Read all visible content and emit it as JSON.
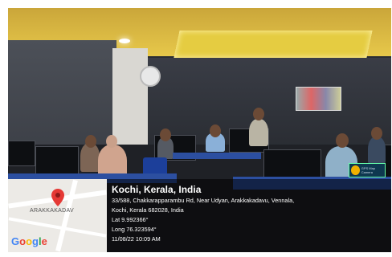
{
  "photo": {
    "description_colors": {
      "ceiling": "#e5cc41",
      "desk": "#2c4fa0",
      "overlay": "#000000"
    }
  },
  "map": {
    "label": "ARAKKAKADAV",
    "logo": "Google",
    "pin_icon": "map-pin-icon",
    "logo_colors": [
      "#4285F4",
      "#EA4335",
      "#FBBC05",
      "#4285F4",
      "#34A853",
      "#EA4335"
    ]
  },
  "location": {
    "title": "Kochi, Kerala, India",
    "address_line1": "33/588, Chakkarapparambu Rd, Near Udyan, Arakkakadavu, Vennala,",
    "address_line2": "Kochi, Kerala 682028, India",
    "lat": "Lat 9.992366°",
    "long": "Long 76.323594°",
    "timestamp": "11/08/22 10:09 AM"
  },
  "watermark": {
    "icon": "gps-camera-icon",
    "text": "GPS Map Camera"
  }
}
